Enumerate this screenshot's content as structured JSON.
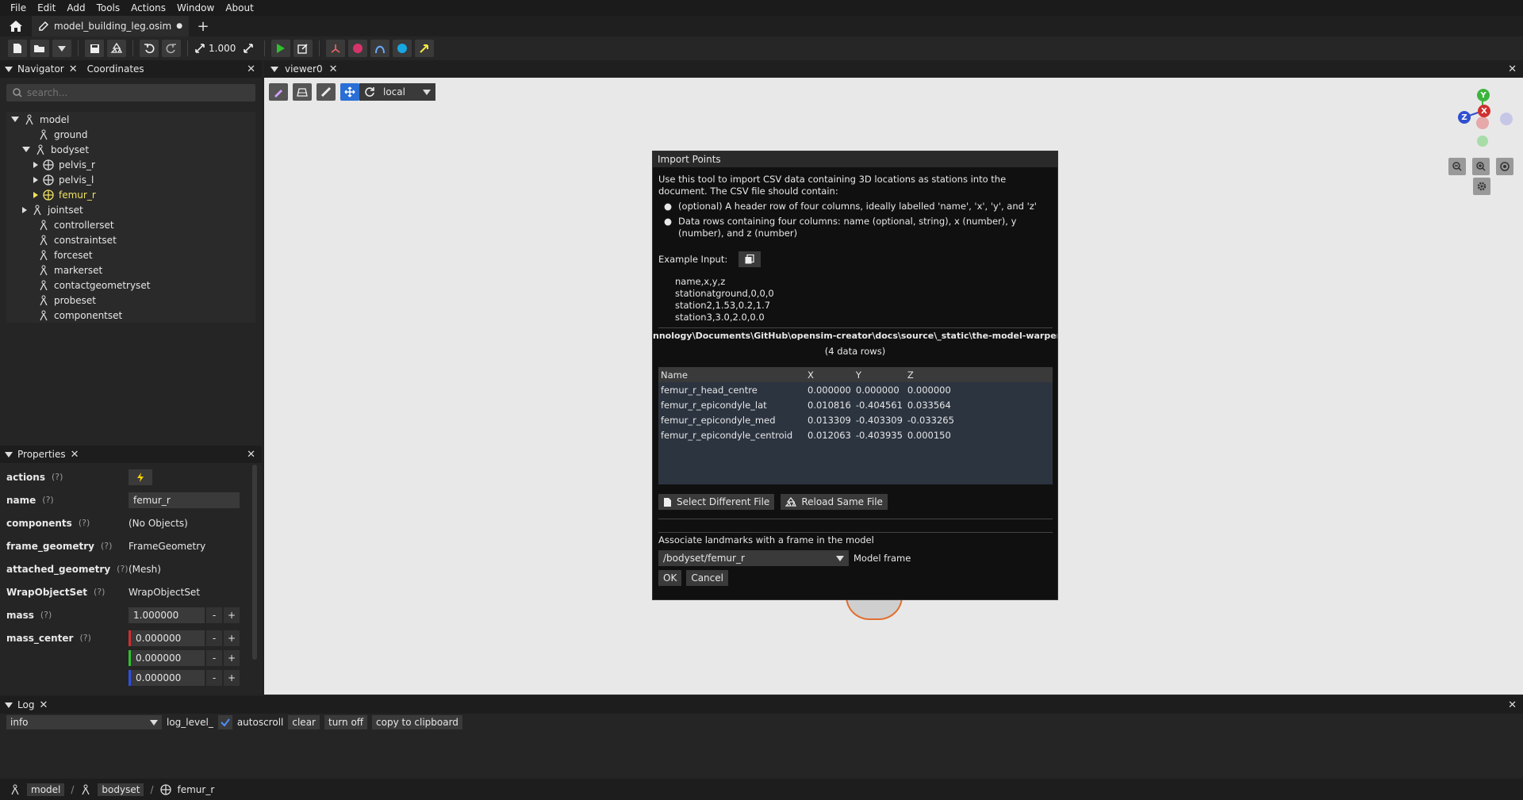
{
  "menubar": {
    "items": [
      "File",
      "Edit",
      "Add",
      "Tools",
      "Actions",
      "Window",
      "About"
    ]
  },
  "tabs": {
    "document_title": "model_building_leg.osim",
    "unsaved_marker": "●",
    "add_label": "+"
  },
  "toolbar": {
    "scale_value": "1.000"
  },
  "navigator": {
    "title": "Navigator",
    "coordinates_tab": "Coordinates",
    "search_placeholder": "search...",
    "tree": [
      {
        "label": "model"
      },
      {
        "label": "ground"
      },
      {
        "label": "bodyset"
      },
      {
        "label": "pelvis_r"
      },
      {
        "label": "pelvis_l"
      },
      {
        "label": "femur_r"
      },
      {
        "label": "jointset"
      },
      {
        "label": "controllerset"
      },
      {
        "label": "constraintset"
      },
      {
        "label": "forceset"
      },
      {
        "label": "markerset"
      },
      {
        "label": "contactgeometryset"
      },
      {
        "label": "probeset"
      },
      {
        "label": "componentset"
      }
    ]
  },
  "properties": {
    "title": "Properties",
    "help": "(?)",
    "rows": {
      "actions": {
        "name": "actions"
      },
      "name": {
        "name": "name",
        "value": "femur_r"
      },
      "components": {
        "name": "components",
        "value": "(No Objects)"
      },
      "frame_geometry": {
        "name": "frame_geometry",
        "value": "FrameGeometry"
      },
      "attached_geometry": {
        "name": "attached_geometry",
        "value": "(Mesh)"
      },
      "wrapobjectset": {
        "name": "WrapObjectSet",
        "value": "WrapObjectSet"
      },
      "mass": {
        "name": "mass",
        "value": "1.000000"
      },
      "mass_center": {
        "name": "mass_center",
        "values": [
          "0.000000",
          "0.000000",
          "0.000000"
        ]
      }
    },
    "minus": "-",
    "plus": "+"
  },
  "viewer": {
    "title": "viewer0",
    "frame_mode": "local"
  },
  "dialog": {
    "title": "Import Points",
    "intro": "Use this tool to import CSV data containing 3D locations as stations into the document. The CSV file should contain:",
    "bullets": [
      "(optional) A header row of four columns, ideally labelled 'name', 'x', 'y', and 'z'",
      "Data rows containing four columns: name (optional, string), x (number), y (number), and z (number)"
    ],
    "example_label": "Example Input:",
    "example_lines": [
      "name,x,y,z",
      "stationatground,0,0,0",
      "station2,1.53,0.2,1.7",
      "station3,3.0,2.0,0.0"
    ],
    "file_path": "nnology\\Documents\\GitHub\\opensim-creator\\docs\\source\\_static\\the-model-warper\\",
    "row_count": "(4 data rows)",
    "table_headers": [
      "Name",
      "X",
      "Y",
      "Z"
    ],
    "table_rows": [
      [
        "femur_r_head_centre",
        "0.000000",
        "0.000000",
        "0.000000"
      ],
      [
        "femur_r_epicondyle_lat",
        "0.010816",
        "-0.404561",
        "0.033564"
      ],
      [
        "femur_r_epicondyle_med",
        "0.013309",
        "-0.403309",
        "-0.033265"
      ],
      [
        "femur_r_epicondyle_centroid",
        "0.012063",
        "-0.403935",
        "0.000150"
      ]
    ],
    "select_file_btn": "Select Different File",
    "reload_btn": "Reload Same File",
    "associate_label": "Associate landmarks with a frame in the model",
    "frame_value": "/bodyset/femur_r",
    "frame_label": "Model frame",
    "ok": "OK",
    "cancel": "Cancel"
  },
  "gizmo": {
    "y": "Y",
    "x": "X",
    "z": "Z"
  },
  "log": {
    "title": "Log",
    "level": "info",
    "level_label": "log_level_",
    "autoscroll": "autoscroll",
    "clear": "clear",
    "turn_off": "turn off",
    "copy": "copy to clipboard"
  },
  "statusbar": {
    "crumbs": [
      "model",
      "bodyset",
      "femur_r"
    ],
    "sep": "/"
  }
}
